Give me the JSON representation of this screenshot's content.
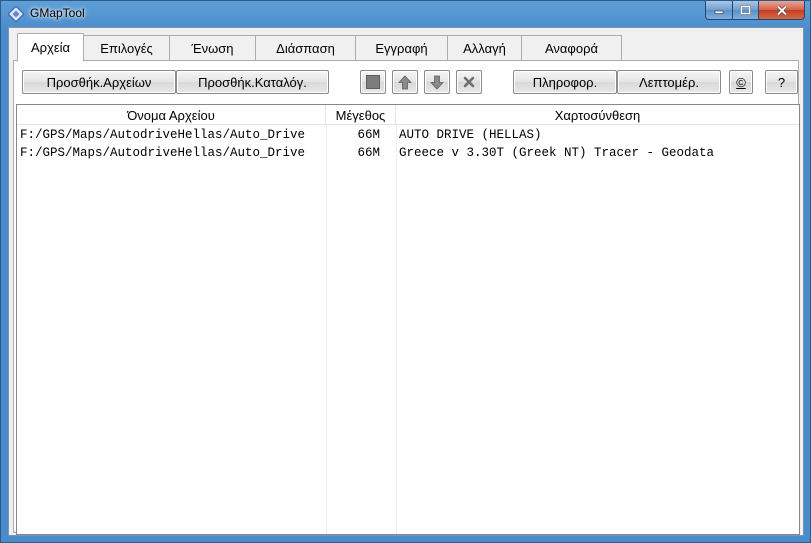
{
  "window": {
    "title": "GMapTool",
    "controls": {
      "minimize": "minimize",
      "maximize": "maximize",
      "close": "close"
    }
  },
  "tabs": [
    {
      "label": "Αρχεία",
      "active": true
    },
    {
      "label": "Επιλογές"
    },
    {
      "label": "Ένωση"
    },
    {
      "label": "Διάσπαση"
    },
    {
      "label": "Εγγραφή"
    },
    {
      "label": "Αλλαγή"
    },
    {
      "label": "Αναφορά"
    }
  ],
  "toolbar": {
    "add_files": "Προσθήκ.Αρχείων",
    "add_folder": "Προσθήκ.Καταλόγ.",
    "info": "Πληροφορ.",
    "details": "Λεπτομέρ.",
    "copyright": "©",
    "help": "?"
  },
  "table": {
    "columns": [
      "Όνομα Αρχείου",
      "Μέγεθος",
      "Χαρτοσύνθεση"
    ],
    "rows": [
      {
        "file": "F:/GPS/Maps/AutodriveHellas/Auto_Drive",
        "size": "66M",
        "map": "AUTO DRIVE (HELLAS)"
      },
      {
        "file": "F:/GPS/Maps/AutodriveHellas/Auto_Drive",
        "size": "66M",
        "map": "Greece v 3.30T (Greek NT) Tracer - Geodata"
      }
    ]
  },
  "colors": {
    "accent": "#4a8ccb",
    "close": "#c43c20"
  }
}
